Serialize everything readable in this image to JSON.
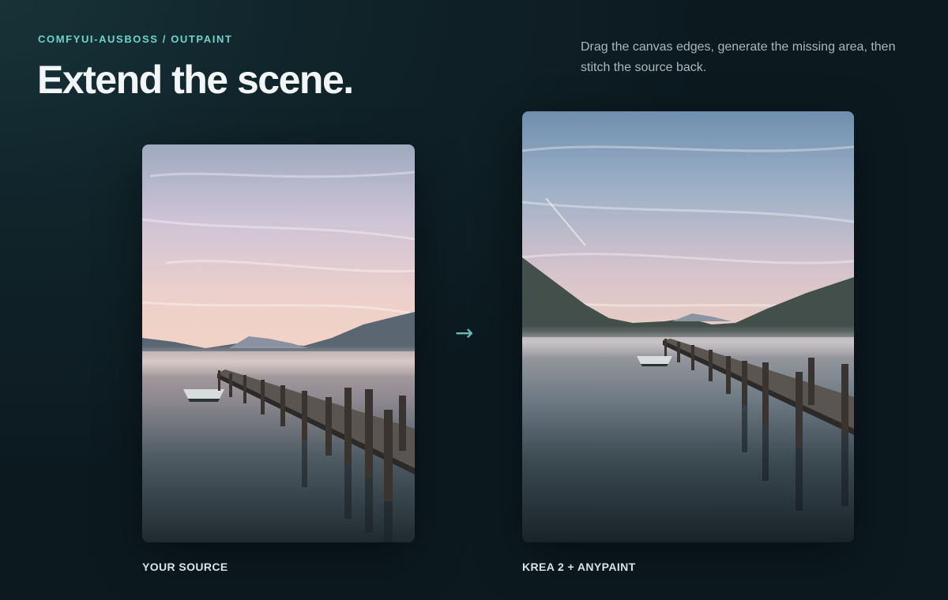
{
  "header": {
    "eyebrow": "COMFYUI-AUSBOSS / OUTPAINT",
    "title": "Extend the scene.",
    "description": "Drag the canvas edges, generate the missing area, then stitch the source back."
  },
  "comparison": {
    "source_caption": "YOUR SOURCE",
    "result_caption": "KREA 2 + ANYPAINT",
    "arrow_glyph": "→"
  },
  "colors": {
    "accent": "#6fd3c9",
    "background": "#10242a"
  }
}
